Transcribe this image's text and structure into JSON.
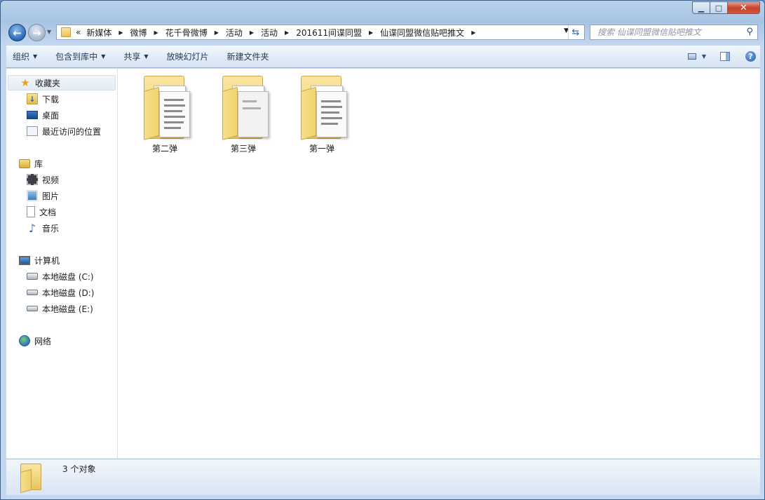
{
  "window": {
    "minimize_glyph": "▁",
    "maximize_glyph": "□",
    "close_glyph": "✕"
  },
  "address_bar": {
    "overflow_glyph": "«",
    "crumbs": [
      "新媒体",
      "微博",
      "花千骨微博",
      "活动",
      "活动",
      "201611间谍同盟",
      "仙谍同盟微信贴吧推文"
    ]
  },
  "search": {
    "placeholder": "搜索 仙谍同盟微信贴吧推文"
  },
  "toolbar": {
    "organize": "组织",
    "include_in_library": "包含到库中",
    "share": "共享",
    "slideshow": "放映幻灯片",
    "new_folder": "新建文件夹"
  },
  "nav": {
    "favorites": "收藏夹",
    "downloads": "下载",
    "desktop": "桌面",
    "recent": "最近访问的位置",
    "libraries": "库",
    "videos": "视频",
    "pictures": "图片",
    "documents": "文档",
    "music": "音乐",
    "computer": "计算机",
    "drive_c": "本地磁盘 (C:)",
    "drive_d": "本地磁盘 (D:)",
    "drive_e": "本地磁盘 (E:)",
    "network": "网络"
  },
  "folders": [
    {
      "name": "第二弹"
    },
    {
      "name": "第三弹"
    },
    {
      "name": "第一弹"
    }
  ],
  "status": {
    "count_text": "3 个对象"
  },
  "colors": {
    "selection_bg": "#e4ecf6",
    "close_button": "#c5432a",
    "folder_yellow": "#eac862"
  }
}
